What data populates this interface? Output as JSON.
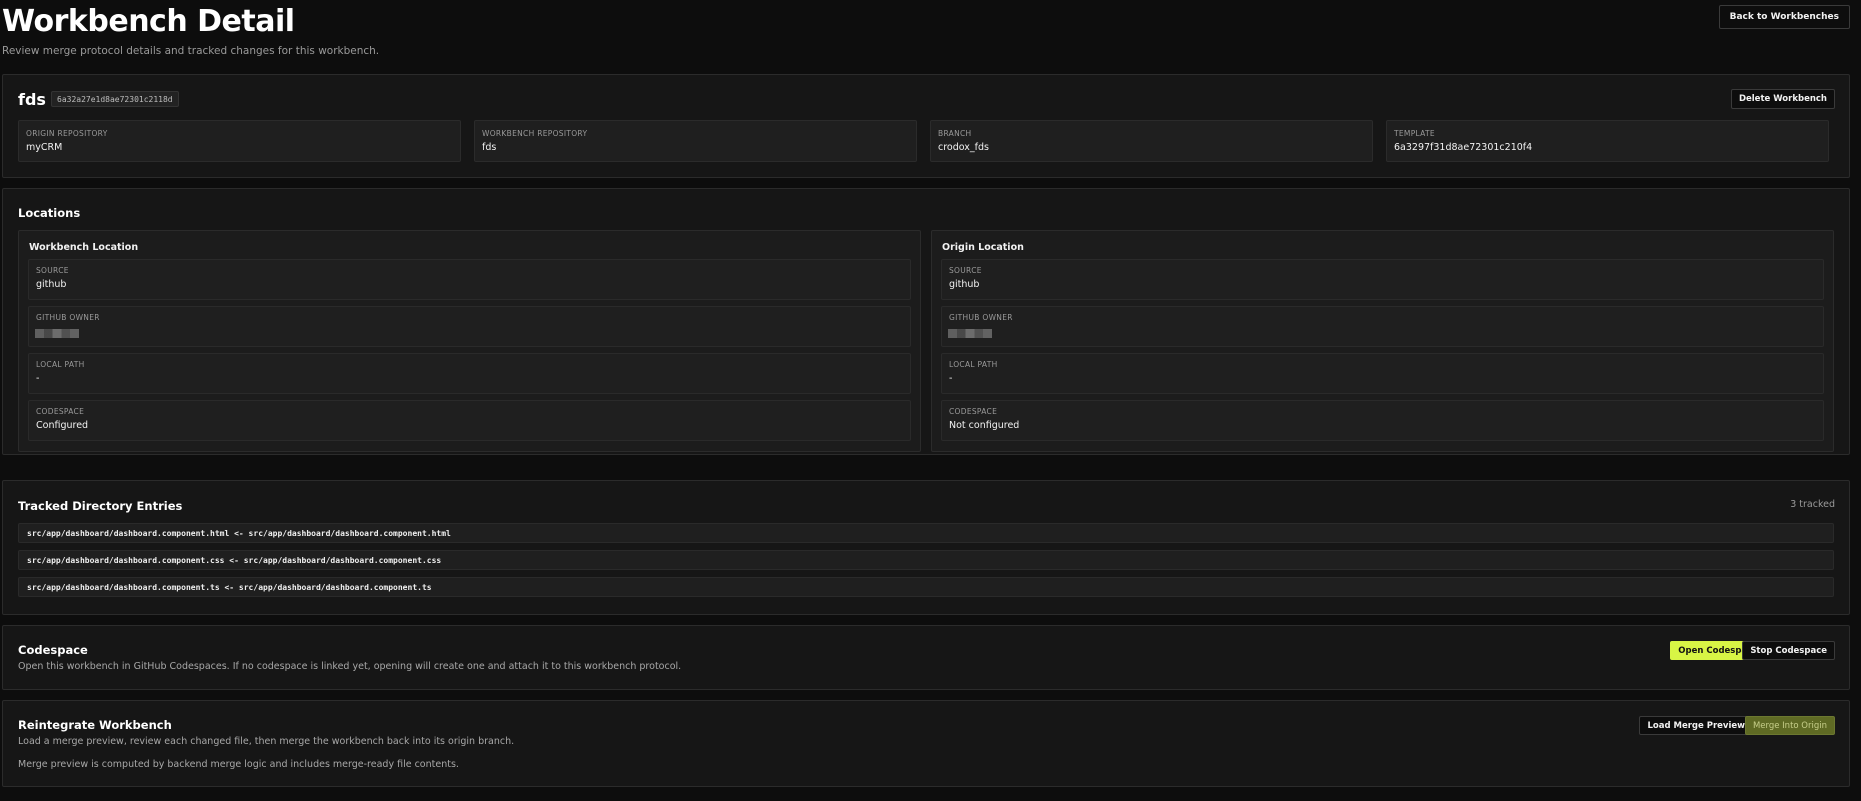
{
  "header": {
    "title": "Workbench Detail",
    "subtitle": "Review merge protocol details and tracked changes for this workbench.",
    "back_label": "Back to Workbenches"
  },
  "overview": {
    "name": "fds",
    "id": "6a32a27e1d8ae72301c2118d",
    "delete_label": "Delete Workbench",
    "fields": [
      {
        "label": "Origin Repository",
        "value": "myCRM"
      },
      {
        "label": "Workbench Repository",
        "value": "fds"
      },
      {
        "label": "Branch",
        "value": "crodox_fds"
      },
      {
        "label": "Template",
        "value": "6a3297f31d8ae72301c210f4"
      }
    ]
  },
  "locations": {
    "title": "Locations",
    "workbench": {
      "title": "Workbench Location",
      "source_label": "Source",
      "source": "github",
      "owner_label": "GitHub Owner",
      "owner": "",
      "path_label": "Local Path",
      "path": "-",
      "codespace_label": "Codespace",
      "codespace": "Configured"
    },
    "origin": {
      "title": "Origin Location",
      "source_label": "Source",
      "source": "github",
      "owner_label": "GitHub Owner",
      "owner": "",
      "path_label": "Local Path",
      "path": "-",
      "codespace_label": "Codespace",
      "codespace": "Not configured"
    }
  },
  "tracked": {
    "title": "Tracked Directory Entries",
    "count": "3 tracked",
    "entries": [
      "src/app/dashboard/dashboard.component.html <- src/app/dashboard/dashboard.component.html",
      "src/app/dashboard/dashboard.component.css <- src/app/dashboard/dashboard.component.css",
      "src/app/dashboard/dashboard.component.ts <- src/app/dashboard/dashboard.component.ts"
    ]
  },
  "codespace": {
    "title": "Codespace",
    "description": "Open this workbench in GitHub Codespaces. If no codespace is linked yet, opening will create one and attach it to this workbench protocol.",
    "open_label": "Open Codespace",
    "stop_label": "Stop Codespace"
  },
  "reintegrate": {
    "title": "Reintegrate Workbench",
    "description": "Load a merge preview, review each changed file, then merge the workbench back into its origin branch.",
    "note": "Merge preview is computed by backend merge logic and includes merge-ready file contents.",
    "preview_label": "Load Merge Preview",
    "merge_label": "Merge Into Origin"
  },
  "colors": {
    "background": "#0d0d0d",
    "panel": "#161616",
    "accent": "#d8f545"
  }
}
